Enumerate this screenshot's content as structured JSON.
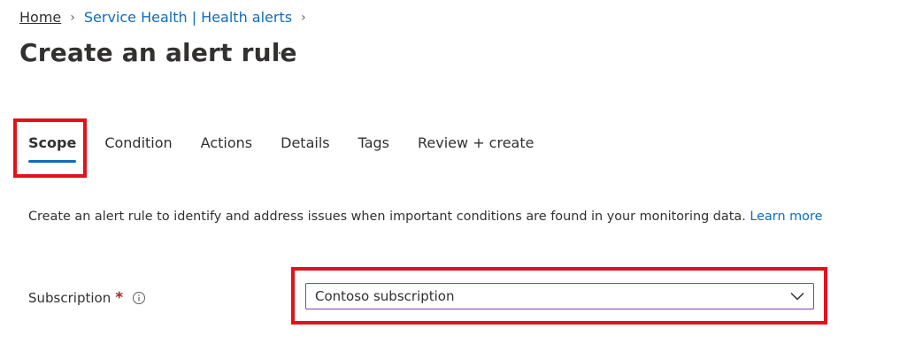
{
  "breadcrumb": {
    "items": [
      "Home",
      "Service Health | Health alerts"
    ]
  },
  "page": {
    "title": "Create an alert rule",
    "more_label": "···"
  },
  "tabs": [
    {
      "label": "Scope",
      "active": true
    },
    {
      "label": "Condition",
      "active": false
    },
    {
      "label": "Actions",
      "active": false
    },
    {
      "label": "Details",
      "active": false
    },
    {
      "label": "Tags",
      "active": false
    },
    {
      "label": "Review + create",
      "active": false
    }
  ],
  "description": {
    "text": "Create an alert rule to identify and address issues when important conditions are found in your monitoring data.",
    "learn_more": "Learn more"
  },
  "subscription": {
    "label": "Subscription",
    "required_marker": "*",
    "value": "Contoso subscription"
  },
  "colors": {
    "accent": "#0f6cbd",
    "highlight": "#e3111b",
    "required": "#a4262c",
    "select_border": "#8a3fae"
  },
  "icons": [
    "chevron-right-icon",
    "more-icon",
    "info-icon",
    "chevron-down-icon"
  ]
}
